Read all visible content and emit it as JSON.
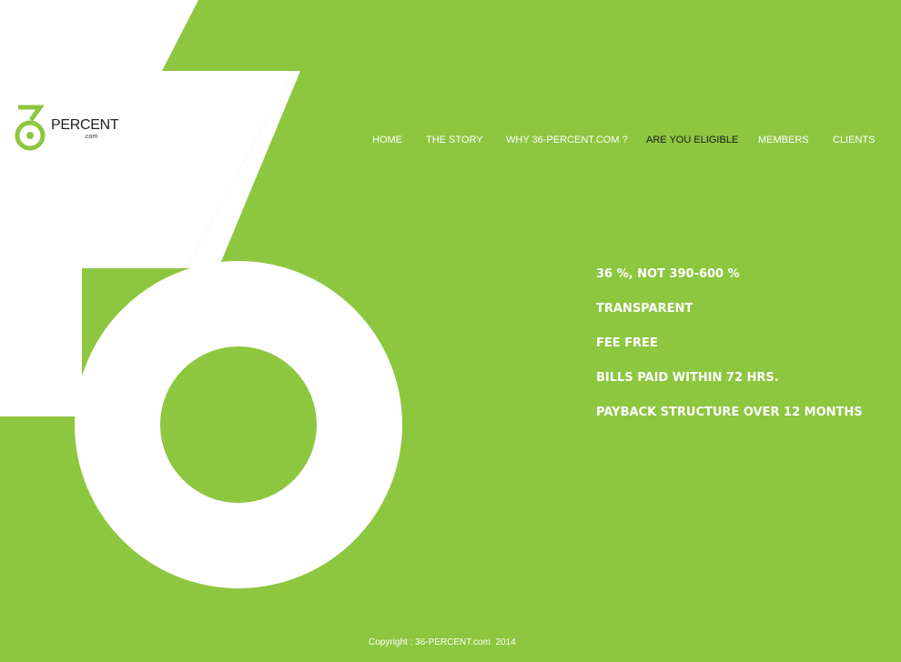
{
  "brand": {
    "logo_digit": "3",
    "logo_text": "PERCENT",
    "logo_sub": ".com",
    "green": "#8dc63f",
    "white": "#ffffff"
  },
  "nav": {
    "items": [
      {
        "label": "HOME",
        "active": false
      },
      {
        "label": "THE STORY",
        "active": false
      },
      {
        "label": "WHY 36-PERCENT.COM ?",
        "active": false
      },
      {
        "label": "ARE YOU ELIGIBLE",
        "active": true
      },
      {
        "label": "MEMBERS",
        "active": false
      },
      {
        "label": "CLIENTS",
        "active": false
      }
    ]
  },
  "features": [
    "36 %, NOT 390-600 %",
    "TRANSPARENT",
    "FEE FREE",
    "BILLS PAID WITHIN 72 HRS.",
    "PAYBACK STRUCTURE OVER 12 MONTHS"
  ],
  "hero": {
    "graphic": "large-36-numeral"
  },
  "footer": {
    "copyright": "Copyright : 36-PERCENT.com  2014"
  }
}
